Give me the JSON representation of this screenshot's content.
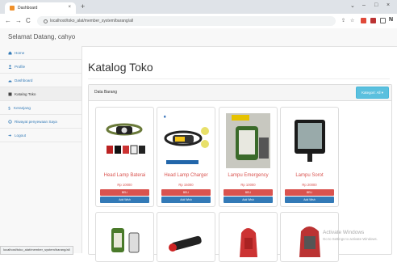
{
  "browser": {
    "tab_title": "Dashboard",
    "tab_close": "×",
    "new_tab": "+",
    "win_min": "⌄",
    "win_min2": "–",
    "win_max": "□",
    "win_close": "×",
    "url": "localhost/toko_alat/member_system/barang/all",
    "status_url": "localhost/toko_alat/member_system/barang/all"
  },
  "navbar": {
    "brand": "Selamat Datang, cahyo"
  },
  "sidebar": {
    "items": [
      {
        "label": "Home",
        "icon": "home-icon"
      },
      {
        "label": "Profile",
        "icon": "user-icon"
      },
      {
        "label": "Dashboard",
        "icon": "dashboard-icon"
      },
      {
        "label": "Katalog Toko",
        "icon": "catalog-icon"
      },
      {
        "label": "Keranjang",
        "icon": "cart-icon"
      },
      {
        "label": "Riwayat penyewaan Saya",
        "icon": "history-icon"
      },
      {
        "label": "Logout",
        "icon": "logout-icon"
      }
    ]
  },
  "main": {
    "title": "Katalog Toko",
    "panel_title": "Data Barang",
    "kategori_button": "Kategori: All ▾"
  },
  "products": [
    {
      "name": "Head Lamp Baterai",
      "price": "Rp 10000",
      "beli": "BELI",
      "wish": "Add Wish"
    },
    {
      "name": "Head Lamp Charger",
      "price": "Rp 15000",
      "beli": "BELI",
      "wish": "Add Wish"
    },
    {
      "name": "Lampu Emergency",
      "price": "Rp 10000",
      "beli": "BELI",
      "wish": "Add Wish"
    },
    {
      "name": "Lampu Sorot",
      "price": "Rp 20000",
      "beli": "BELI",
      "wish": "Add Wish"
    }
  ],
  "watermark": {
    "title": "Activate Windows",
    "sub": "Go to Settings to activate Windows."
  },
  "colors": {
    "accent": "#337ab7",
    "danger": "#d9534f",
    "info": "#5bc0de"
  }
}
